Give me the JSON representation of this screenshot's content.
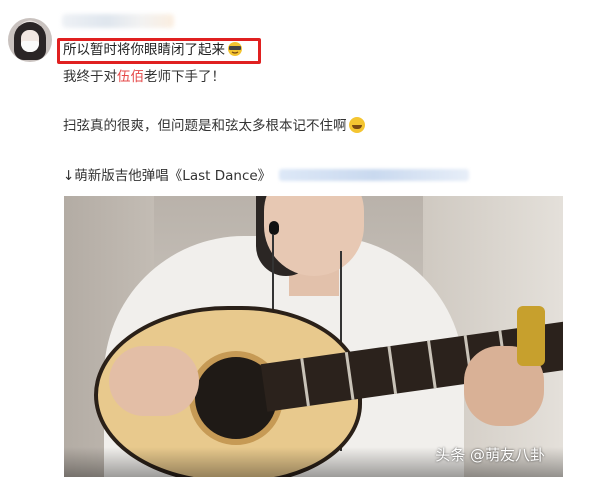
{
  "post": {
    "line1": "所以暂时将你眼睛闭了起来",
    "line2_before": "我终于对",
    "line2_highlight": "伍佰",
    "line2_after": "老师下手了！",
    "line3": "扫弦真的很爽，但问题是和弦太多根本记不住啊",
    "line4": "↓萌新版吉他弹唱《Last Dance》",
    "emoji_line1": "hidden-face-emoji-icon",
    "emoji_line3": "laugh-emoji-icon"
  },
  "video": {
    "watermark": "头条 @萌友八卦"
  },
  "colors": {
    "highlight_border": "#e02020",
    "name_highlight": "#e64a4a"
  }
}
